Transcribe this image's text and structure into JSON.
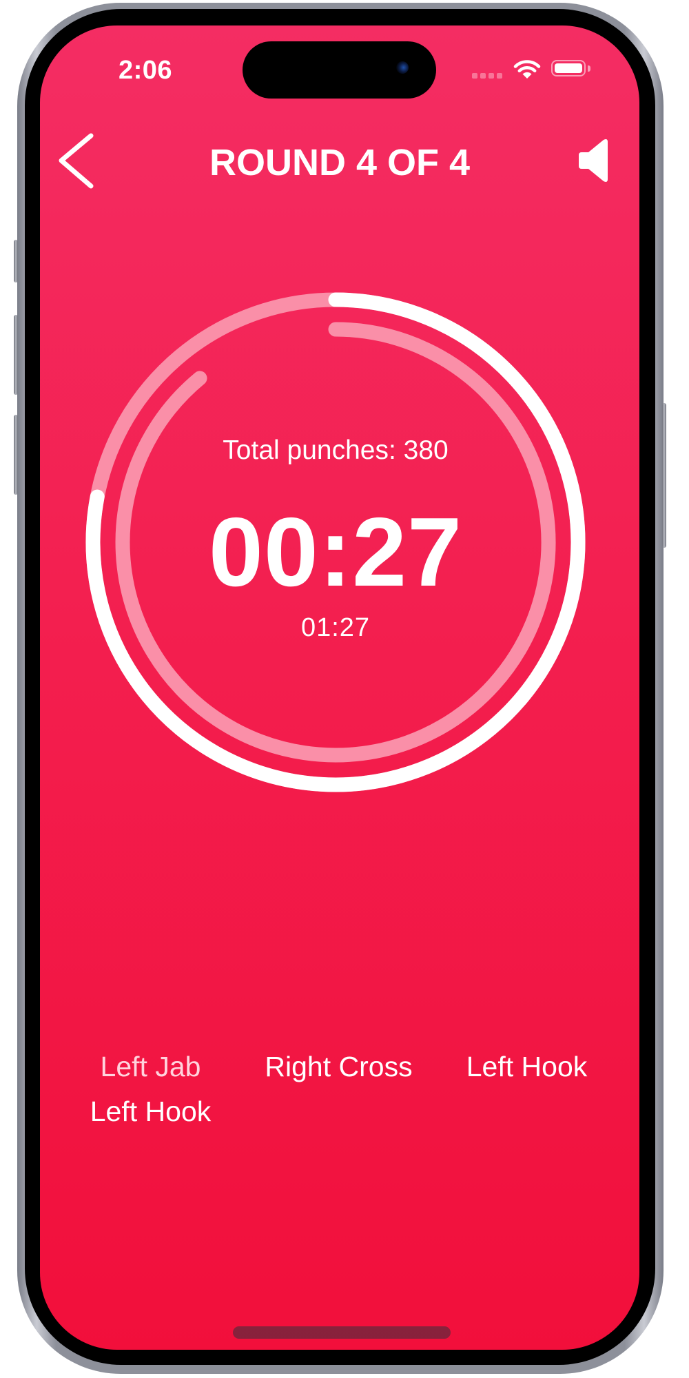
{
  "status_bar": {
    "time": "2:06",
    "signal_bars": 4,
    "signal_active_bars": 0,
    "wifi_icon": "wifi-icon",
    "battery_level": 1.0
  },
  "header": {
    "back_icon": "chevron-left-icon",
    "title": "ROUND 4 OF 4",
    "sound_icon": "speaker-icon"
  },
  "timer": {
    "total_punches_label": "Total punches: 380",
    "total_punches": 380,
    "round_time_remaining": "00:27",
    "total_time_remaining": "01:27",
    "outer_ring_progress": 0.78,
    "inner_ring_progress": 0.89
  },
  "combo": {
    "punches": [
      {
        "label": "Left Jab",
        "state": "done"
      },
      {
        "label": "Right Cross",
        "state": "pending"
      },
      {
        "label": "Left Hook",
        "state": "pending"
      },
      {
        "label": "Left Hook",
        "state": "pending"
      }
    ]
  },
  "colors": {
    "background_top": "#F42D63",
    "background_bottom": "#F20F3B",
    "ring_active": "#FFFFFF",
    "ring_track": "#FA8FA8",
    "text": "#FFFFFF"
  }
}
